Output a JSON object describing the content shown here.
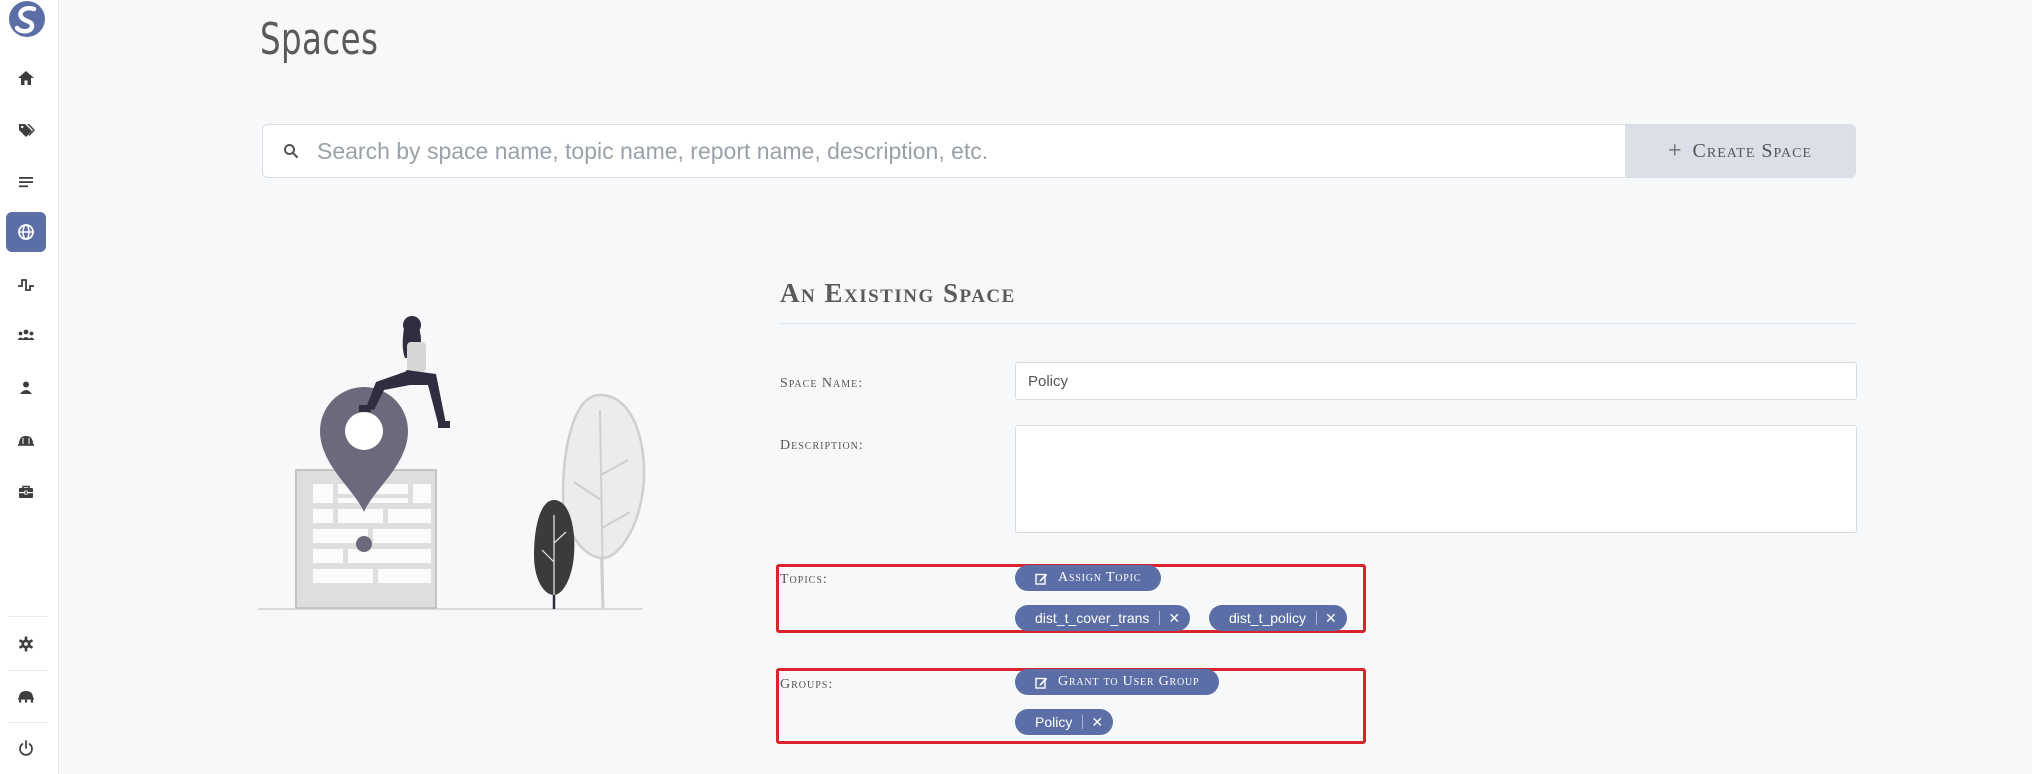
{
  "page": {
    "title": "Spaces"
  },
  "search": {
    "placeholder": "Search by space name, topic name, report name, description, etc.",
    "value": ""
  },
  "actions": {
    "create_space_label": "Create Space",
    "create_space_icon": "plus-icon"
  },
  "sidebar": {
    "active_index": 3,
    "items": [
      {
        "icon": "home-icon"
      },
      {
        "icon": "tags-icon"
      },
      {
        "icon": "menu-lines-icon"
      },
      {
        "icon": "globe-icon"
      },
      {
        "icon": "pulse-icon"
      },
      {
        "icon": "users-icon"
      },
      {
        "icon": "user-icon"
      },
      {
        "icon": "dome-icon"
      },
      {
        "icon": "toolbox-icon"
      }
    ],
    "bottom_items": [
      {
        "icon": "gear-icon"
      },
      {
        "icon": "network-icon"
      },
      {
        "icon": "power-icon"
      }
    ]
  },
  "form": {
    "heading": "An Existing Space",
    "space_name_label": "Space Name:",
    "space_name_value": "Policy",
    "description_label": "Description:",
    "description_value": "",
    "topics_label": "Topics:",
    "assign_topic_label": "Assign Topic",
    "topics": [
      "dist_t_cover_trans",
      "dist_t_policy"
    ],
    "groups_label": "Groups:",
    "grant_group_label": "Grant to User Group",
    "groups": [
      "Policy"
    ],
    "remove_glyph": "✕"
  },
  "colors": {
    "accent": "#5b6fa6",
    "highlight": "#d9232d",
    "create_button_bg": "#dbe0e8",
    "page_bg": "#f7f8fa"
  }
}
